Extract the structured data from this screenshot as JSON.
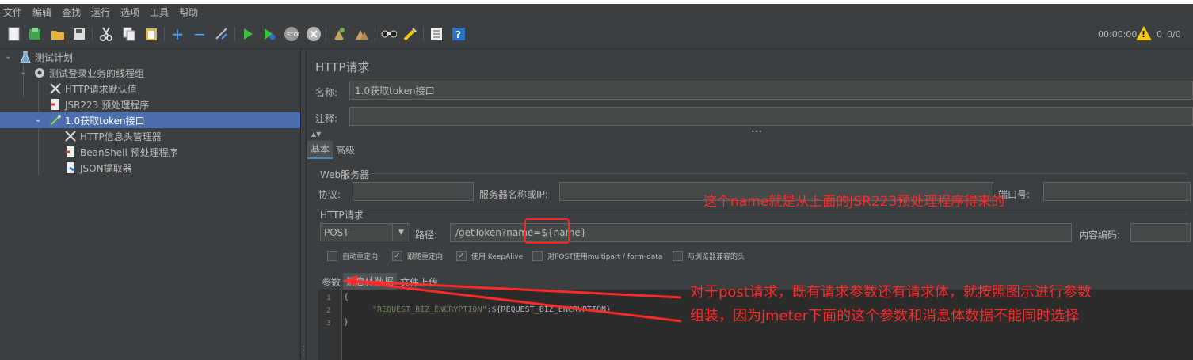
{
  "menubar": [
    "文件",
    "编辑",
    "查找",
    "运行",
    "选项",
    "工具",
    "帮助"
  ],
  "toolbar": {
    "icons": [
      "new-icon",
      "templates-icon",
      "open-icon",
      "save-icon",
      "cut-icon",
      "copy-icon",
      "paste-icon",
      "expand-icon",
      "collapse-icon",
      "toggle-icon",
      "start-icon",
      "start-no-pause-icon",
      "stop-icon",
      "shutdown-icon",
      "clear-icon",
      "clear-all-icon",
      "search-icon",
      "reset-search-icon",
      "function-helper-icon",
      "help-icon"
    ],
    "timer": "00:00:00",
    "warn_count": "0",
    "ratio": "0/0"
  },
  "tree": [
    {
      "label": "测试计划",
      "icon": "flask-icon"
    },
    {
      "label": "测试登录业务的线程组",
      "icon": "gear-icon"
    },
    {
      "label": "HTTP请求默认值",
      "icon": "wrench-icon"
    },
    {
      "label": "JSR223 预处理程序",
      "icon": "script-icon"
    },
    {
      "label": "1.0获取token接口",
      "icon": "pipette-icon"
    },
    {
      "label": "HTTP信息头管理器",
      "icon": "wrench-icon"
    },
    {
      "label": "BeanShell 预处理程序",
      "icon": "script-icon"
    },
    {
      "label": "JSON提取器",
      "icon": "doc-icon"
    }
  ],
  "panel": {
    "title": "HTTP请求",
    "name_label": "名称:",
    "name_value": "1.0获取token接口",
    "comment_label": "注释:",
    "comment_value": "",
    "tabs": [
      "基本",
      "高级"
    ],
    "web_server_group": "Web服务器",
    "protocol_label": "协议:",
    "server_label": "服务器名称或IP:",
    "port_label": "端口号:",
    "http_group": "HTTP请求",
    "method": "POST",
    "path_label": "路径:",
    "path_value": "/getToken?name=${name}",
    "encoding_label": "内容编码:",
    "checkboxes": [
      {
        "label": "自动重定向",
        "checked": false
      },
      {
        "label": "跟随重定向",
        "checked": true
      },
      {
        "label": "使用 KeepAlive",
        "checked": true
      },
      {
        "label": "对POST使用multipart / form-data",
        "checked": false
      },
      {
        "label": "与浏览器兼容的头",
        "checked": false
      }
    ],
    "sub_tabs": [
      "参数",
      "消息体数据",
      "文件上传"
    ],
    "code_lines": [
      {
        "no": "1",
        "text": "{"
      },
      {
        "no": "2",
        "key": "\"REQUEST_BIZ_ENCRYPTION\"",
        "rest": ":${REQUEST_BIZ_ENCRYPTION}"
      },
      {
        "no": "3",
        "text": "}"
      }
    ]
  },
  "annotations": {
    "note1": "这个name就是从上面的JSR223预处理程序得来的",
    "note2_line1": "对于post请求，既有请求参数还有请求体，就按照图示进行参数",
    "note2_line2": "组装，因为jmeter下面的这个参数和消息体数据不能同时选择"
  },
  "colors": {
    "background": "#3c3f41",
    "selection": "#4b6eaf",
    "annotation": "#ff2a2a",
    "editor": "#2b2b2b"
  }
}
